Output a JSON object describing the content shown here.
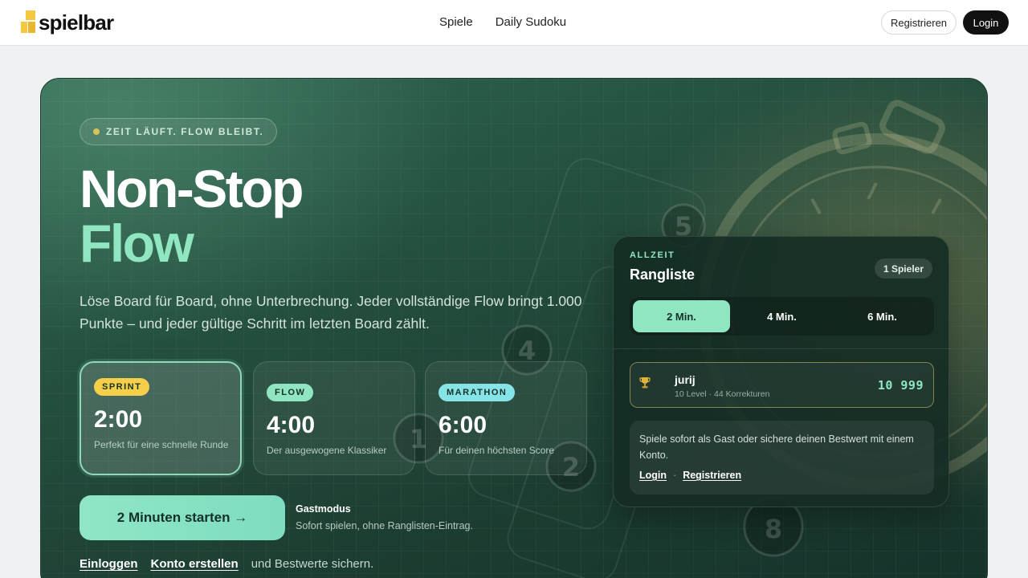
{
  "brand": {
    "name": "spielbar"
  },
  "nav": {
    "items": [
      "Spiele",
      "Daily Sudoku"
    ]
  },
  "header_actions": {
    "register": "Registrieren",
    "login": "Login"
  },
  "hero": {
    "tagline": "ZEIT LÄUFT. FLOW BLEIBT.",
    "title_line1": "Non-Stop",
    "title_line2": "Flow",
    "description": "Löse Board für Board, ohne Unterbrechung. Jeder vollständige Flow bringt 1.000 Punkte – und jeder gültige Schritt im letzten Board zählt.",
    "modes": [
      {
        "badge": "SPRINT",
        "time": "2:00",
        "subtitle": "Perfekt für eine schnelle Runde",
        "color": "#f5cf4a",
        "active": true
      },
      {
        "badge": "FLOW",
        "time": "4:00",
        "subtitle": "Der ausgewogene Klassiker",
        "color": "#8fe6c0",
        "active": false
      },
      {
        "badge": "MARATHON",
        "time": "6:00",
        "subtitle": "Für deinen höchsten Score",
        "color": "#86e3e8",
        "active": false
      }
    ],
    "start_button": "2 Minuten starten →",
    "guest_title": "Gastmodus",
    "guest_subtitle": "Sofort spielen, ohne Ranglisten-Eintrag.",
    "bottom": {
      "login": "Einloggen",
      "create": "Konto erstellen",
      "suffix": "und Bestwerte sichern."
    }
  },
  "leaderboard": {
    "kicker": "ALLZEIT",
    "title": "Rangliste",
    "player_count": "1 Spieler",
    "tabs": [
      "2 Min.",
      "4 Min.",
      "6 Min."
    ],
    "selected_tab": "2 Min.",
    "entries": [
      {
        "name": "jurij",
        "meta": "10 Level · 44 Korrekturen",
        "score": "10 999"
      }
    ],
    "info_text": "Spiele sofort als Gast oder sichere deinen Bestwert mit einem Konto.",
    "info_login": "Login",
    "info_separator": "·",
    "info_register": "Registrieren"
  },
  "colors": {
    "accent": "#8fe6c0",
    "dark_green": "#1c3d31",
    "brand_yellow": "#f5c842"
  },
  "icons": {
    "trophy": "trophy-icon",
    "tag_dot": "status-dot-icon"
  }
}
